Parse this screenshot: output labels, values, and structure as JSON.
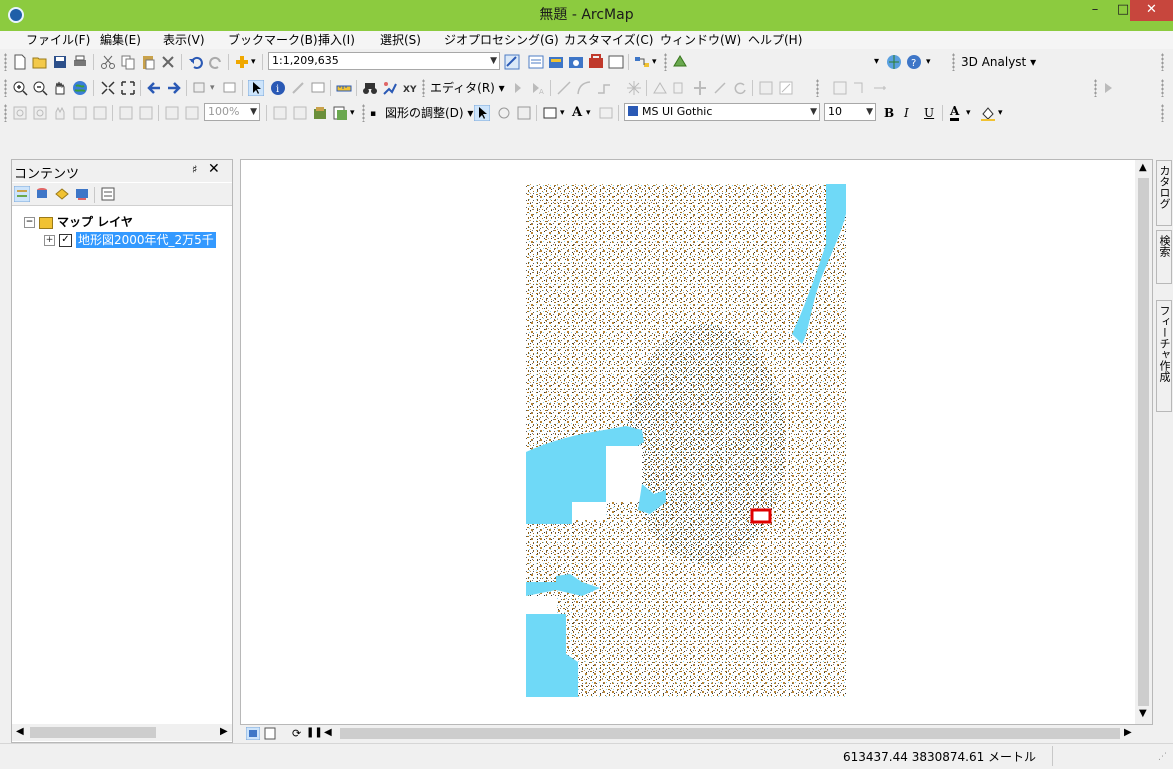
{
  "window": {
    "title": "無題 - ArcMap",
    "min_glyph": "–",
    "max_glyph": "□",
    "close_glyph": "✕"
  },
  "menu": [
    "ファイル(F)",
    "編集(E)",
    "表示(V)",
    "ブックマーク(B)",
    "挿入(I)",
    "選択(S)",
    "ジオプロセシング(G)",
    "カスタマイズ(C)",
    "ウィンドウ(W)",
    "ヘルプ(H)"
  ],
  "toolbar": {
    "scale": "1:1,209,635",
    "analyst": "3D Analyst ▾",
    "editor": "エディタ(R) ▾",
    "zoom_percent": "100%",
    "drawing": "図形の調整(D) ▾",
    "font_name": "MS UI Gothic",
    "font_size": "10",
    "bold": "B",
    "italic": "I",
    "underline": "U",
    "font_color": "A"
  },
  "toc": {
    "title": "コンテンツ",
    "pin": "♯",
    "close": "✕",
    "root_label": "マップ レイヤ",
    "layer_label": "地形図2000年代_2万5千",
    "layer_checked": true
  },
  "dock_tabs": {
    "catalog": "カタログ",
    "search": "検索",
    "feature": "フィーチャ作成"
  },
  "status": {
    "coords": "613437.44  3830874.61 メートル"
  },
  "colors": {
    "titlebar": "#8ccb3f",
    "selection": "#3399ff",
    "water": "#6fd9f7",
    "terrain": "#a8741d",
    "marker": "#e00000"
  }
}
